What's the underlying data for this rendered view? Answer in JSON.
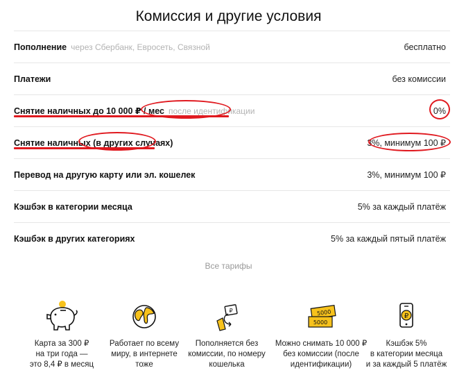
{
  "page_title": "Комиссия и другие условия",
  "rows": [
    {
      "name": "Пополнение",
      "note": "через Сбербанк, Евросеть, Связной",
      "value": "бесплатно"
    },
    {
      "name": "Платежи",
      "note": "",
      "value": "без комиссии"
    },
    {
      "name": "Снятие наличных до 10 000 ₽ / мес",
      "note": "после идентификации",
      "value": "0%"
    },
    {
      "name": "Снятие наличных (в других случаях)",
      "note": "",
      "value": "3%, минимум 100 ₽"
    },
    {
      "name": "Перевод на другую карту или эл. кошелек",
      "note": "",
      "value": "3%, минимум 100 ₽"
    },
    {
      "name": "Кэшбэк в категории месяца",
      "note": "",
      "value": "5% за каждый платёж"
    },
    {
      "name": "Кэшбэк в других категориях",
      "note": "",
      "value": "5% за каждый пятый платёж"
    }
  ],
  "all_tariffs_link": "Все тарифы",
  "features": [
    {
      "icon": "piggy-bank-icon",
      "lines": [
        "Карта за 300 ₽",
        "на три года —",
        "это 8,4 ₽ в месяц"
      ]
    },
    {
      "icon": "globe-icon",
      "lines": [
        "Работает по всему",
        "миру, в интернете",
        "тоже"
      ]
    },
    {
      "icon": "wallet-topup-icon",
      "lines": [
        "Пополняется без",
        "комиссии, по номеру",
        "кошелька"
      ]
    },
    {
      "icon": "banknotes-icon",
      "banknote_label": "5000",
      "lines": [
        "Можно снимать 10 000 ₽",
        "без комиссии (после",
        "идентификации)"
      ]
    },
    {
      "icon": "phone-ruble-icon",
      "lines": [
        "Кэшбэк 5%",
        "в категории месяца",
        "и за каждый 5 платёж"
      ]
    }
  ],
  "colors": {
    "accent": "#f7c21c",
    "annotation": "#e0191f",
    "muted": "#b3b3b3",
    "divider": "#e6e6e6"
  }
}
